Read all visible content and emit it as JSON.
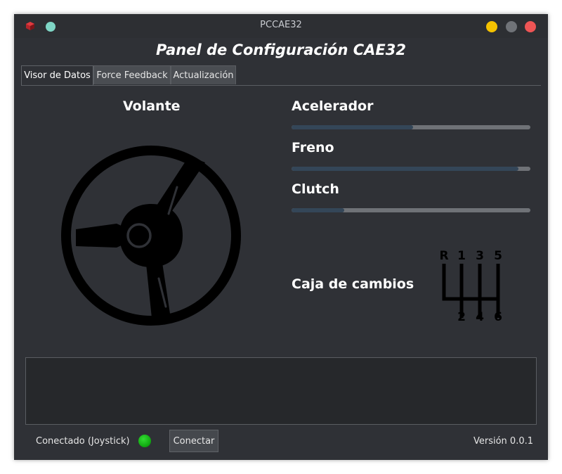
{
  "window": {
    "title": "PCCAE32"
  },
  "header": {
    "panel_title": "Panel de Configuración CAE32"
  },
  "tabs": [
    {
      "label": "Visor de Datos",
      "active": true
    },
    {
      "label": "Force Feedback",
      "active": false
    },
    {
      "label": "Actualización",
      "active": false
    }
  ],
  "steering": {
    "label": "Volante",
    "icon": "steering-wheel-icon"
  },
  "pedals": [
    {
      "label": "Acelerador",
      "level": 0.51
    },
    {
      "label": "Freno",
      "level": 0.95
    },
    {
      "label": "Clutch",
      "level": 0.22
    }
  ],
  "gearbox": {
    "label": "Caja de cambios",
    "icon": "gear-shift-pattern-icon",
    "positions_top": [
      "R",
      "1",
      "3",
      "5"
    ],
    "positions_bottom": [
      "2",
      "4",
      "6"
    ]
  },
  "status_bar": {
    "connection_text": "Conectado (Joystick)",
    "connected": true,
    "connect_button": "Conectar",
    "version": "Versión 0.0.1"
  },
  "colors": {
    "background": "#2f3136",
    "slider_fill": "#344658",
    "slider_track": "#6f7277",
    "status_led": "#22cc22",
    "minimize": "#f5c200",
    "maximize": "#707378",
    "close": "#ee5555",
    "pin": "#7fd6c6"
  }
}
